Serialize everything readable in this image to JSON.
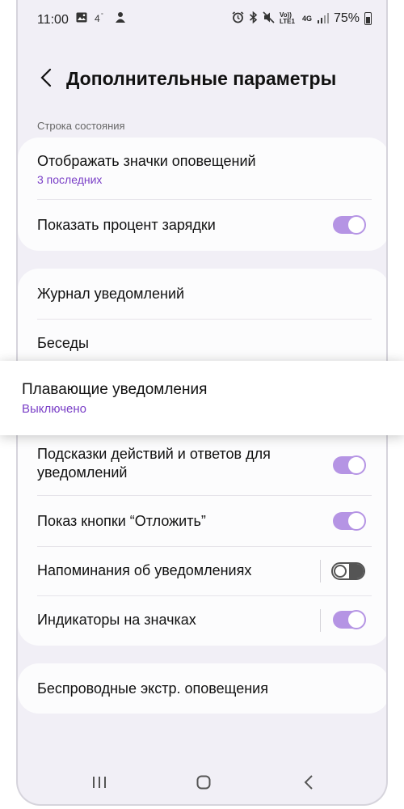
{
  "status_bar": {
    "time": "11:00",
    "left_icons": [
      "image-icon",
      "4g-signal-icon",
      "person-icon"
    ],
    "right_icons": [
      "alarm-icon",
      "bluetooth-icon",
      "mute-icon",
      "volte-icon",
      "4g-data-icon",
      "signal-icon"
    ],
    "volte_label": "Vo)) LTE1",
    "network_label": "4G",
    "battery": "75%"
  },
  "header": {
    "title": "Дополнительные параметры",
    "back_icon": "chevron-left-icon"
  },
  "section_status_bar": {
    "label": "Строка состояния",
    "items": [
      {
        "title": "Отображать значки оповещений",
        "subtitle": "3 последних"
      },
      {
        "title": "Показать процент зарядки",
        "toggle": true
      }
    ]
  },
  "section_notifications": {
    "items": [
      {
        "title": "Журнал уведомлений"
      },
      {
        "title": "Беседы"
      },
      {
        "title": "Плавающие уведомления",
        "subtitle": "Выключено"
      },
      {
        "title_line1": "Подсказки действий и ответов для",
        "title_line2": "уведомлений",
        "toggle": true
      },
      {
        "title": "Показ кнопки “Отложить”",
        "toggle": true
      },
      {
        "title": "Напоминания об уведомлениях",
        "toggle": false
      },
      {
        "title": "Индикаторы на значках",
        "toggle": true
      }
    ]
  },
  "section_emergency": {
    "items": [
      {
        "title": "Беспроводные экстр. оповещения"
      }
    ]
  },
  "nav_bar": {
    "icons": [
      "recents-icon",
      "home-icon",
      "back-icon"
    ]
  },
  "colors": {
    "accent": "#7a3fc7",
    "toggle_on": "#b594e4",
    "background": "#f1eff6",
    "card": "#fcfcfd"
  }
}
